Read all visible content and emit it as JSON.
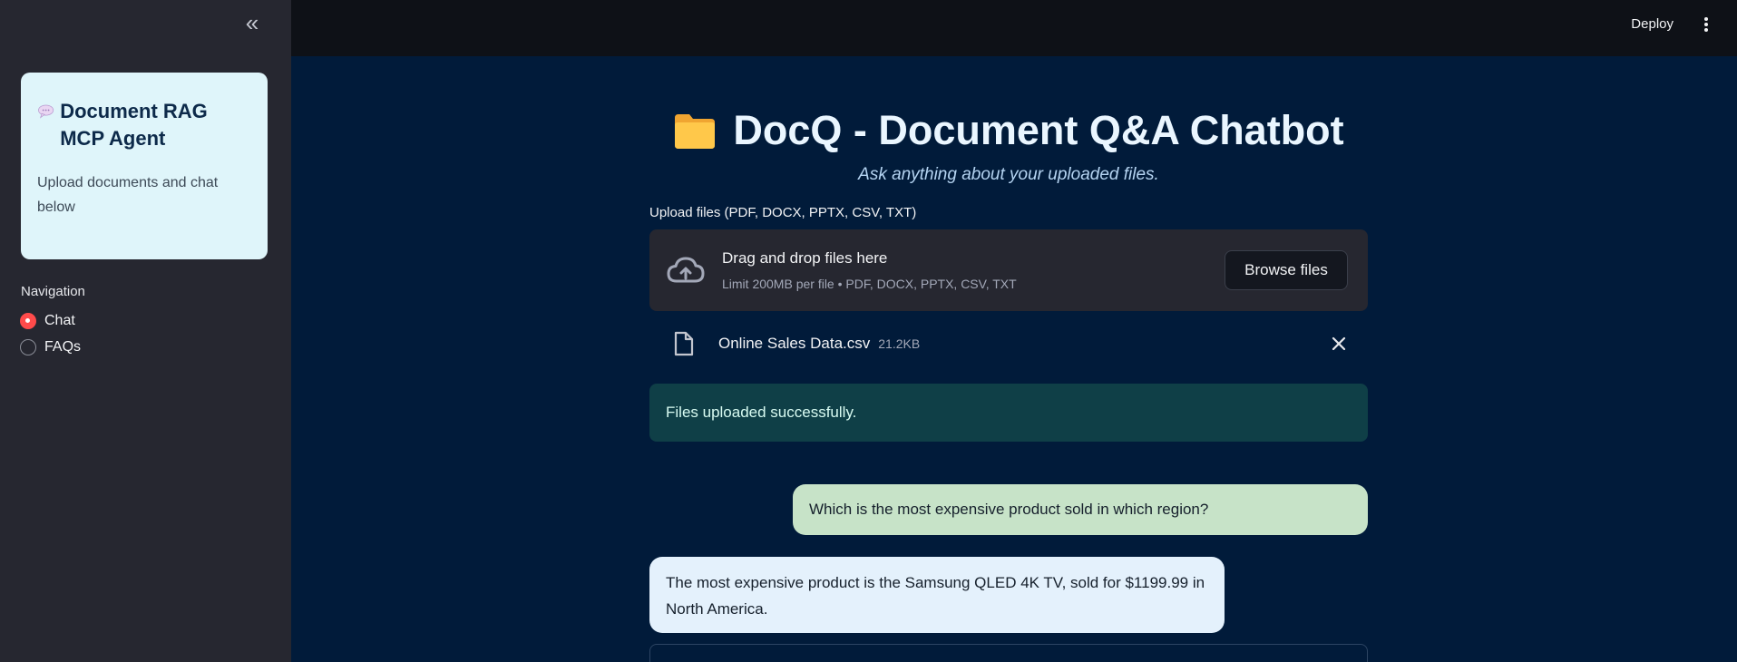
{
  "sidebar": {
    "collapse_glyph": "«",
    "card": {
      "title": "Document RAG MCP Agent",
      "description": "Upload documents and chat below",
      "icon": "speech-bubble-icon"
    },
    "nav_label": "Navigation",
    "nav_options": [
      {
        "label": "Chat",
        "selected": true
      },
      {
        "label": "FAQs",
        "selected": false
      }
    ]
  },
  "header": {
    "deploy_label": "Deploy"
  },
  "main": {
    "title": "DocQ - Document Q&A Chatbot",
    "title_icon": "folder-icon",
    "subtitle": "Ask anything about your uploaded files.",
    "uploader": {
      "label": "Upload files (PDF, DOCX, PPTX, CSV, TXT)",
      "drop_text": "Drag and drop files here",
      "limit_text": "Limit 200MB per file • PDF, DOCX, PPTX, CSV, TXT",
      "browse_label": "Browse files"
    },
    "uploaded_file": {
      "name": "Online Sales Data.csv",
      "size": "21.2KB"
    },
    "success_message": "Files uploaded successfully.",
    "chat": [
      {
        "role": "user",
        "text": "Which is the most expensive product sold in which region?"
      },
      {
        "role": "assistant",
        "text": "The most expensive product is the Samsung QLED 4K TV, sold for $1199.99 in North America."
      }
    ]
  },
  "colors": {
    "sidebar_bg": "#262730",
    "main_bg": "#011b3a",
    "accent_red": "#ff4b4b",
    "user_bubble": "#c7e3c8",
    "assistant_bubble": "#e4f1fc",
    "success_bg": "#0f3f47"
  }
}
